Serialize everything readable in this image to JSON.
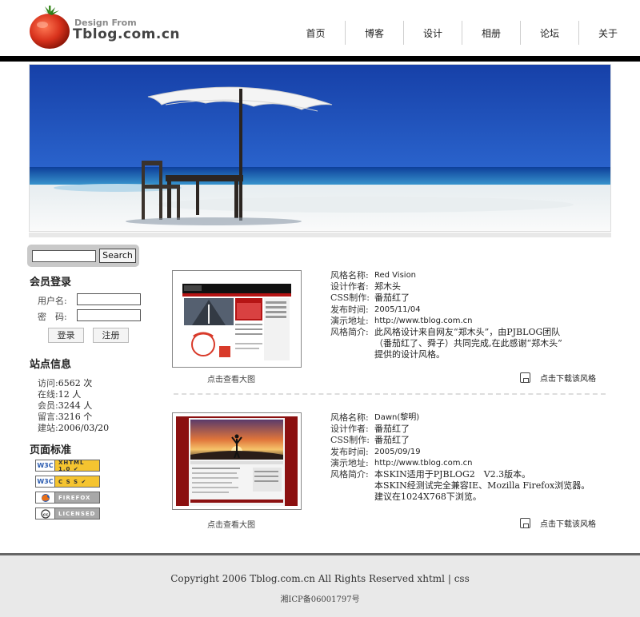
{
  "logo": {
    "sub": "Design From",
    "main": "Tblog.com.cn"
  },
  "nav": {
    "items": [
      "首页",
      "博客",
      "设计",
      "相册",
      "论坛",
      "关于"
    ]
  },
  "search": {
    "value": "",
    "button_label": "Search"
  },
  "login": {
    "title": "会员登录",
    "username_label": "用户名:",
    "password_label": "密　码:",
    "login_button": "登录",
    "register_button": "注册"
  },
  "stats": {
    "title": "站点信息",
    "rows": [
      {
        "label": "访问:",
        "value": "6562 次"
      },
      {
        "label": "在线:",
        "value": "12 人"
      },
      {
        "label": "会员:",
        "value": "3244 人"
      },
      {
        "label": "留言:",
        "value": "3216 个"
      },
      {
        "label": "建站:",
        "value": "2006/03/20"
      }
    ]
  },
  "standards": {
    "title": "页面标准",
    "badges": [
      {
        "left": "W3C",
        "right": "XHTML 1.0 ✔"
      },
      {
        "left": "W3C",
        "right": "C S S ✔"
      },
      {
        "left": "ff",
        "right": "FIREFOX"
      },
      {
        "left": "cc",
        "right": "LICENSED"
      }
    ]
  },
  "skins": [
    {
      "name_label": "风格名称:",
      "name": "Red Vision",
      "designer_label": "设计作者:",
      "designer": "郑木头",
      "css_label": "CSS制作:",
      "css_author": "番茄红了",
      "date_label": "发布时间:",
      "date": "2005/11/04",
      "demo_label": "演示地址:",
      "demo": "http://www.tblog.com.cn",
      "intro_label": "风格简介:",
      "intro_lines": [
        "此风格设计来自网友“郑木头”，由PJBLOG团队",
        "（番茄红了、舜子）共同完成,在此感谢“郑木头”",
        "提供的设计风格。"
      ],
      "thumb_caption": "点击查看大图",
      "download_label": "点击下载该风格"
    },
    {
      "name_label": "风格名称:",
      "name": "Dawn(黎明)",
      "designer_label": "设计作者:",
      "designer": "番茄红了",
      "css_label": "CSS制作:",
      "css_author": "番茄红了",
      "date_label": "发布时间:",
      "date": "2005/09/19",
      "demo_label": "演示地址:",
      "demo": "http://www.tblog.com.cn",
      "intro_label": "风格简介:",
      "intro_lines": [
        "本SKIN适用于PJBLOG2　V2.3版本。",
        "本SKIN经测试完全兼容IE、Mozilla Firefox浏览器。",
        "建议在1024X768下浏览。"
      ],
      "thumb_caption": "点击查看大图",
      "download_label": "点击下载该风格"
    }
  ],
  "footer": {
    "copyright": "Copyright 2006 Tblog.com.cn All Rights Reserved xhtml | css",
    "icp": "湘ICP备06001797号"
  },
  "colors": {
    "header_bar": "#000000",
    "footer_bg": "#e9e9e9",
    "sea": "#1b4fb3",
    "sand": "#f2f2f2",
    "tomato": "#d8321c",
    "skin_red": "#8b1010"
  }
}
